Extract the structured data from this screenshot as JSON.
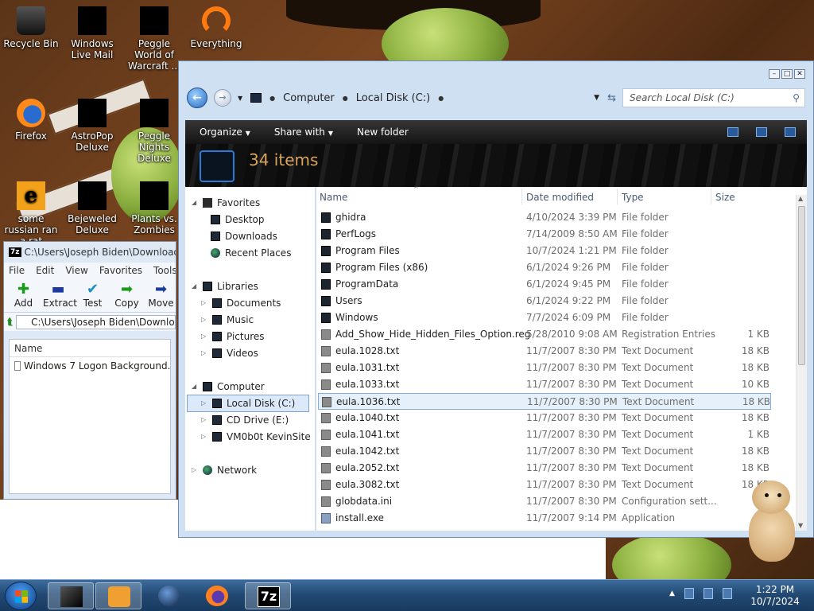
{
  "desktop": {
    "icons": [
      {
        "label": "Recycle Bin"
      },
      {
        "label": "Windows Live Mail"
      },
      {
        "label": "Peggle World of Warcraft ..."
      },
      {
        "label": "Everything"
      },
      {
        "label": "Firefox"
      },
      {
        "label": "AstroPop Deluxe"
      },
      {
        "label": "Peggle Nights Deluxe"
      },
      {
        "label": "some russian ran a rat"
      },
      {
        "label": "Bejeweled Deluxe"
      },
      {
        "label": "Plants vs. Zombies"
      }
    ]
  },
  "sevenzip": {
    "title": "C:\\Users\\Joseph Biden\\Downloads",
    "menu": [
      "File",
      "Edit",
      "View",
      "Favorites",
      "Tools"
    ],
    "toolbar": [
      "Add",
      "Extract",
      "Test",
      "Copy",
      "Move"
    ],
    "address": "C:\\Users\\Joseph Biden\\Downloads",
    "column_name": "Name",
    "files": [
      "Windows 7 Logon Background..."
    ]
  },
  "explorer": {
    "breadcrumb": [
      "Computer",
      "Local Disk (C:)"
    ],
    "search_placeholder": "Search Local Disk (C:)",
    "toolbar": {
      "organize": "Organize",
      "share_with": "Share with",
      "new_folder": "New folder"
    },
    "item_count": "34 items",
    "nav": {
      "favorites": "Favorites",
      "desktop": "Desktop",
      "downloads": "Downloads",
      "recent": "Recent Places",
      "libraries": "Libraries",
      "documents": "Documents",
      "music": "Music",
      "pictures": "Pictures",
      "videos": "Videos",
      "computer": "Computer",
      "local_disk": "Local Disk (C:)",
      "cd_drive": "CD Drive (E:)",
      "vm": "VM0b0t KevinSite",
      "network": "Network"
    },
    "columns": {
      "name": "Name",
      "date": "Date modified",
      "type": "Type",
      "size": "Size"
    },
    "files": [
      {
        "name": "ghidra",
        "date": "4/10/2024 3:39 PM",
        "type": "File folder",
        "size": "",
        "icon": "folder"
      },
      {
        "name": "PerfLogs",
        "date": "7/14/2009 8:50 AM",
        "type": "File folder",
        "size": "",
        "icon": "folder"
      },
      {
        "name": "Program Files",
        "date": "10/7/2024 1:21 PM",
        "type": "File folder",
        "size": "",
        "icon": "folder"
      },
      {
        "name": "Program Files (x86)",
        "date": "6/1/2024 9:26 PM",
        "type": "File folder",
        "size": "",
        "icon": "folder"
      },
      {
        "name": "ProgramData",
        "date": "6/1/2024 9:45 PM",
        "type": "File folder",
        "size": "",
        "icon": "folder"
      },
      {
        "name": "Users",
        "date": "6/1/2024 9:22 PM",
        "type": "File folder",
        "size": "",
        "icon": "folder"
      },
      {
        "name": "Windows",
        "date": "7/7/2024 6:09 PM",
        "type": "File folder",
        "size": "",
        "icon": "folder"
      },
      {
        "name": "Add_Show_Hide_Hidden_Files_Option.reg",
        "date": "5/28/2010 9:08 AM",
        "type": "Registration Entries",
        "size": "1 KB",
        "icon": "doc"
      },
      {
        "name": "eula.1028.txt",
        "date": "11/7/2007 8:30 PM",
        "type": "Text Document",
        "size": "18 KB",
        "icon": "doc"
      },
      {
        "name": "eula.1031.txt",
        "date": "11/7/2007 8:30 PM",
        "type": "Text Document",
        "size": "18 KB",
        "icon": "doc"
      },
      {
        "name": "eula.1033.txt",
        "date": "11/7/2007 8:30 PM",
        "type": "Text Document",
        "size": "10 KB",
        "icon": "doc"
      },
      {
        "name": "eula.1036.txt",
        "date": "11/7/2007 8:30 PM",
        "type": "Text Document",
        "size": "18 KB",
        "icon": "doc",
        "selected": true
      },
      {
        "name": "eula.1040.txt",
        "date": "11/7/2007 8:30 PM",
        "type": "Text Document",
        "size": "18 KB",
        "icon": "doc"
      },
      {
        "name": "eula.1041.txt",
        "date": "11/7/2007 8:30 PM",
        "type": "Text Document",
        "size": "1 KB",
        "icon": "doc"
      },
      {
        "name": "eula.1042.txt",
        "date": "11/7/2007 8:30 PM",
        "type": "Text Document",
        "size": "18 KB",
        "icon": "doc"
      },
      {
        "name": "eula.2052.txt",
        "date": "11/7/2007 8:30 PM",
        "type": "Text Document",
        "size": "18 KB",
        "icon": "doc"
      },
      {
        "name": "eula.3082.txt",
        "date": "11/7/2007 8:30 PM",
        "type": "Text Document",
        "size": "18 KB",
        "icon": "doc"
      },
      {
        "name": "globdata.ini",
        "date": "11/7/2007 8:30 PM",
        "type": "Configuration sett...",
        "size": "",
        "icon": "doc"
      },
      {
        "name": "install.exe",
        "date": "11/7/2007 9:14 PM",
        "type": "Application",
        "size": "",
        "icon": "app"
      }
    ]
  },
  "taskbar": {
    "clock_time": "1:22 PM",
    "clock_date": "10/7/2024"
  }
}
